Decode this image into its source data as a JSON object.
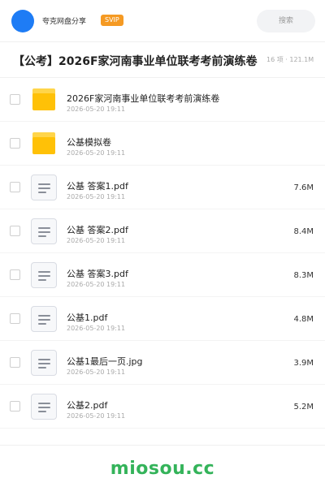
{
  "header": {
    "user_name": "夸克网盘分享",
    "badge": "SVIP",
    "search_placeholder": "搜索"
  },
  "folder": {
    "title": "【公考】2026F家河南事业单位联考考前演练卷",
    "meta": "16 项 · 121.1M"
  },
  "files": [
    {
      "type": "folder",
      "name": "2026F家河南事业单位联考考前演练卷",
      "date": "2026-05-20 19:11",
      "size": ""
    },
    {
      "type": "folder",
      "name": "公基模拟卷",
      "date": "2026-05-20 19:11",
      "size": ""
    },
    {
      "type": "doc",
      "name": "公基  答案1.pdf",
      "date": "2026-05-20 19:11",
      "size": "7.6M"
    },
    {
      "type": "doc",
      "name": "公基  答案2.pdf",
      "date": "2026-05-20 19:11",
      "size": "8.4M"
    },
    {
      "type": "doc",
      "name": "公基  答案3.pdf",
      "date": "2026-05-20 19:11",
      "size": "8.3M"
    },
    {
      "type": "doc",
      "name": "公基1.pdf",
      "date": "2026-05-20 19:11",
      "size": "4.8M"
    },
    {
      "type": "doc",
      "name": "公基1最后一页.jpg",
      "date": "2026-05-20 19:11",
      "size": "3.9M"
    },
    {
      "type": "doc",
      "name": "公基2.pdf",
      "date": "2026-05-20 19:11",
      "size": "5.2M"
    }
  ],
  "footer": {
    "brand": "miosou.cc"
  },
  "colors": {
    "avatar": "#1e7cf5",
    "badge": "#f59a23",
    "folder": "#ffc107",
    "brand": "#34b35a"
  }
}
